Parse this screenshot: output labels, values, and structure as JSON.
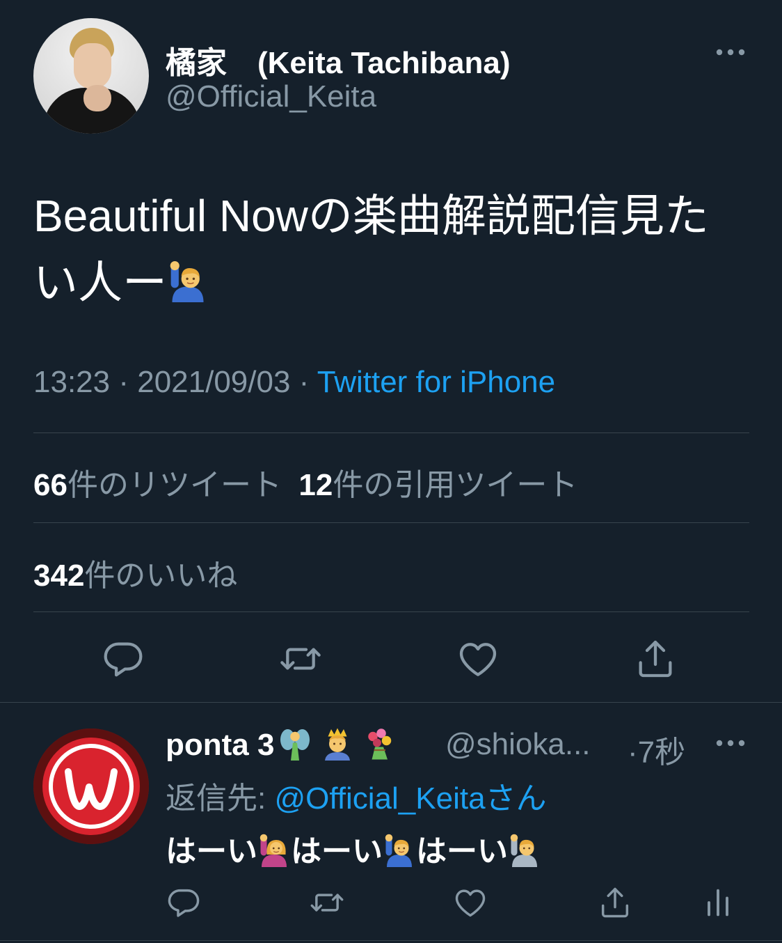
{
  "tweet": {
    "author": {
      "display_name": "橘家　(Keita Tachibana)",
      "handle": "@Official_Keita"
    },
    "text": "Beautiful Nowの楽曲解説配信見たい人ー",
    "text_emoji": "raising-hand-man",
    "time": "13:23",
    "date": "2021/09/03",
    "source": "Twitter for iPhone",
    "retweets_count": "66",
    "retweets_label": "件のリツイート",
    "quotes_count": "12",
    "quotes_label": "件の引用ツイート",
    "likes_count": "342",
    "likes_label": "件のいいね",
    "actions": [
      "reply-icon",
      "retweet-icon",
      "like-icon",
      "share-icon"
    ]
  },
  "reply": {
    "display_name": "ponta 3",
    "name_emojis": [
      "fairy",
      "prince",
      "bouquet"
    ],
    "handle": "@shioka...",
    "time": "·7秒",
    "reply_to_label": "返信先: ",
    "reply_to_mention": "@Official_Keitaさん",
    "text_parts": [
      "はーい",
      "はーい",
      "はーい"
    ],
    "text_emojis": [
      "raising-hand-woman",
      "raising-hand-man",
      "raising-hand-person"
    ],
    "actions": [
      "reply-icon",
      "retweet-icon",
      "like-icon",
      "share-icon",
      "analytics-icon"
    ]
  },
  "colors": {
    "background": "#15202b",
    "text": "#ffffff",
    "secondary": "#8899a6",
    "link": "#1da1f2",
    "divider": "#38444d"
  }
}
